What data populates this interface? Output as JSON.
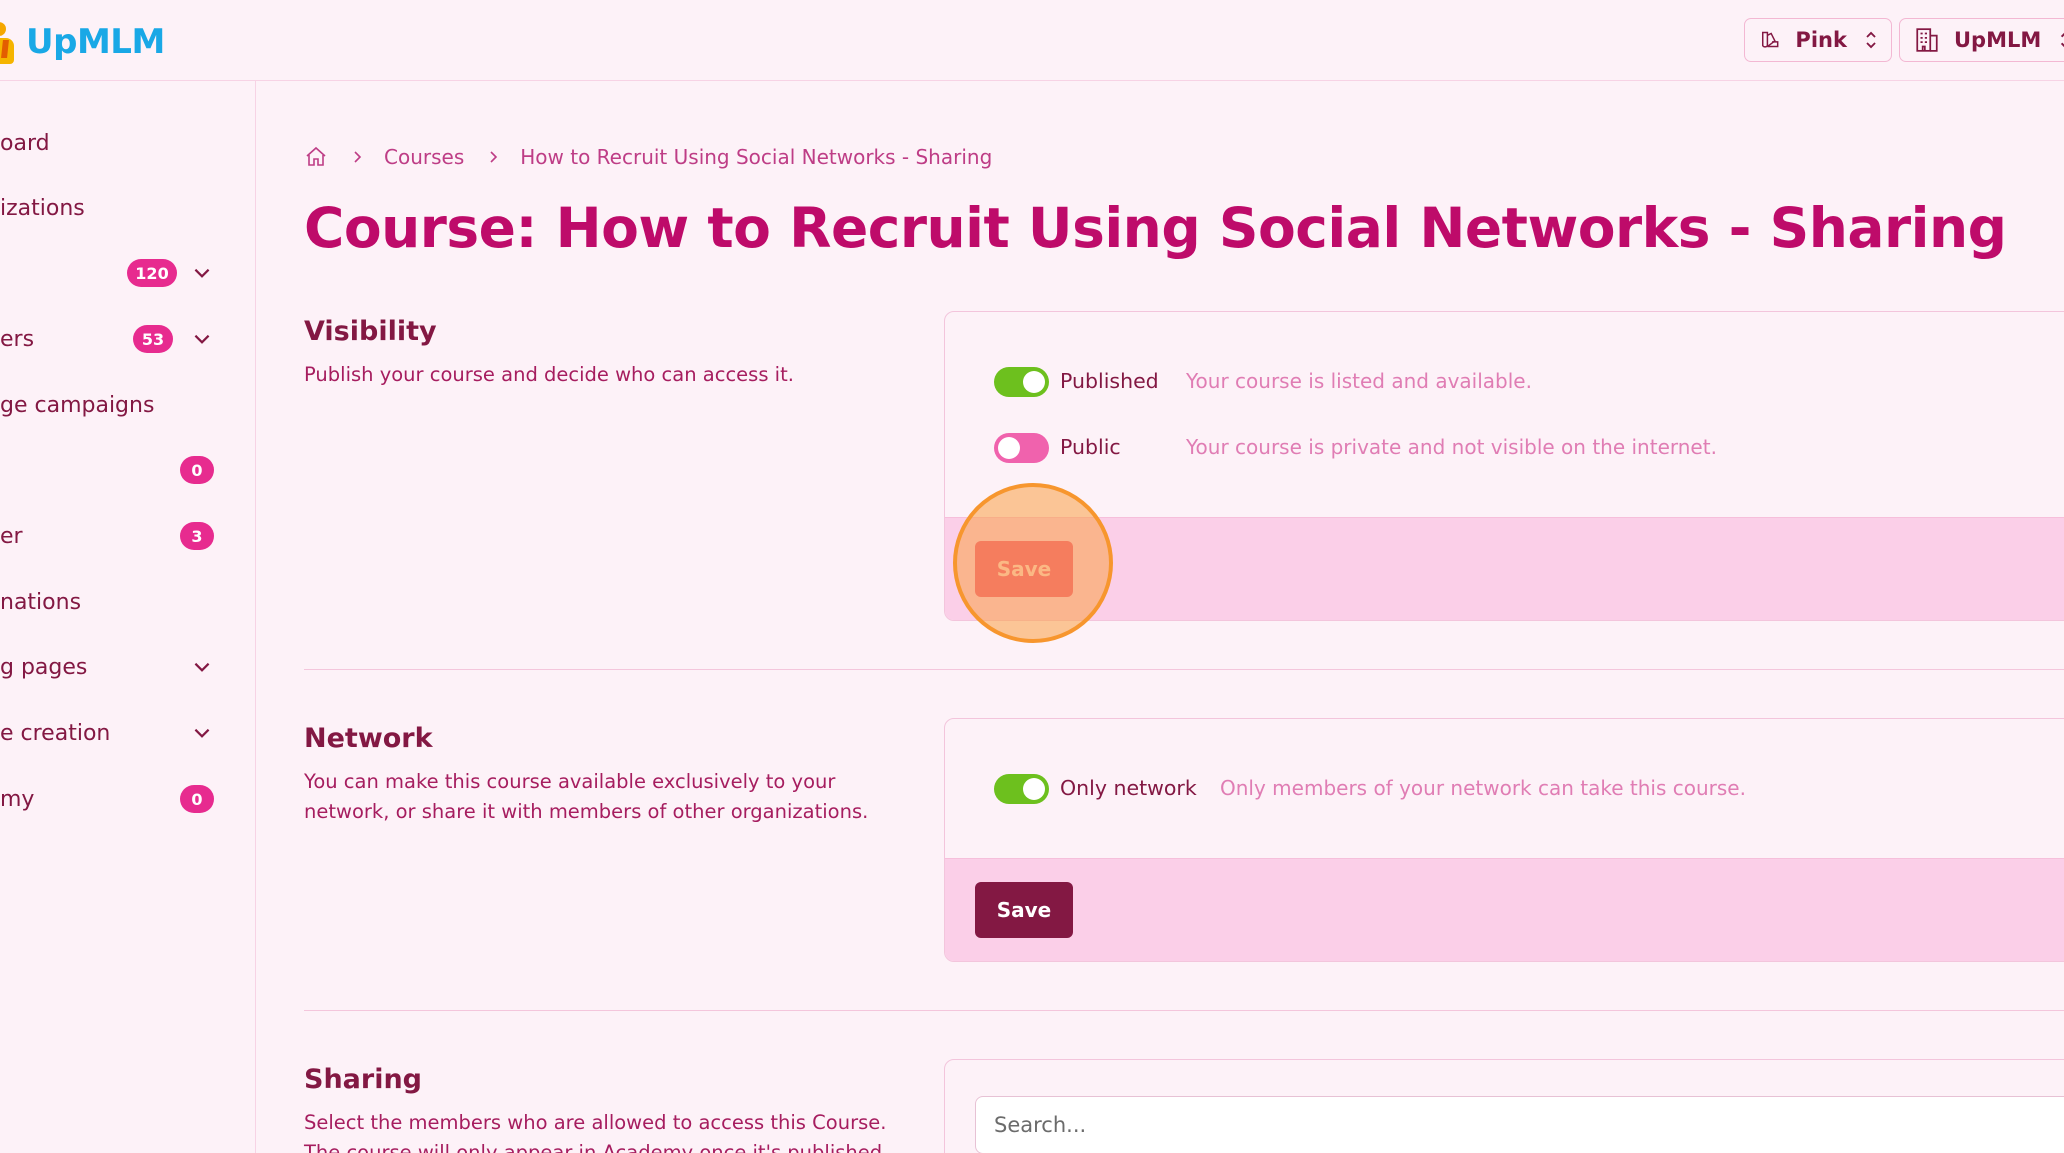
{
  "app": {
    "logo_text": "UpMLM"
  },
  "header": {
    "theme_switcher_label": "Pink",
    "org_switcher_label": "UpMLM"
  },
  "sidebar": {
    "items": [
      {
        "label": "oard"
      },
      {
        "label": "izations"
      },
      {
        "label": "",
        "badge": "120",
        "has_chevron": true
      },
      {
        "label": "ers",
        "badge": "53",
        "has_chevron": true
      },
      {
        "label": "ge campaigns"
      },
      {
        "label": "",
        "badge": "0"
      },
      {
        "label": "er",
        "badge": "3"
      },
      {
        "label": "nations"
      },
      {
        "label": "g pages",
        "has_chevron": true
      },
      {
        "label": "e creation",
        "has_chevron": true
      },
      {
        "label": "my",
        "badge": "0"
      }
    ]
  },
  "breadcrumb": {
    "items": [
      "Courses",
      "How to Recruit Using Social Networks - Sharing"
    ]
  },
  "page": {
    "title": "Course: How to Recruit Using Social Networks - Sharing"
  },
  "sections": {
    "visibility": {
      "title": "Visibility",
      "description": "Publish your course and decide who can access it.",
      "toggles": [
        {
          "label": "Published",
          "state": "on",
          "help": "Your course is listed and available."
        },
        {
          "label": "Public",
          "state": "off",
          "help": "Your course is private and not visible on the internet."
        }
      ],
      "save_label": "Save"
    },
    "network": {
      "title": "Network",
      "description": "You can make this course available exclusively to your network, or share it with members of other organizations.",
      "toggles": [
        {
          "label": "Only network",
          "state": "on",
          "help": "Only members of your network can take this course."
        }
      ],
      "save_label": "Save"
    },
    "sharing": {
      "title": "Sharing",
      "description": "Select the members who are allowed to access this Course. The course will only appear in Academy once it's published.",
      "search_placeholder": "Search..."
    }
  },
  "colors": {
    "accent": "#be0b6a",
    "dark": "#831843",
    "toggle_on": "#6dc01e",
    "toggle_off": "#f062ad",
    "badge": "#e72b8f",
    "background": "#fdf2f8"
  }
}
